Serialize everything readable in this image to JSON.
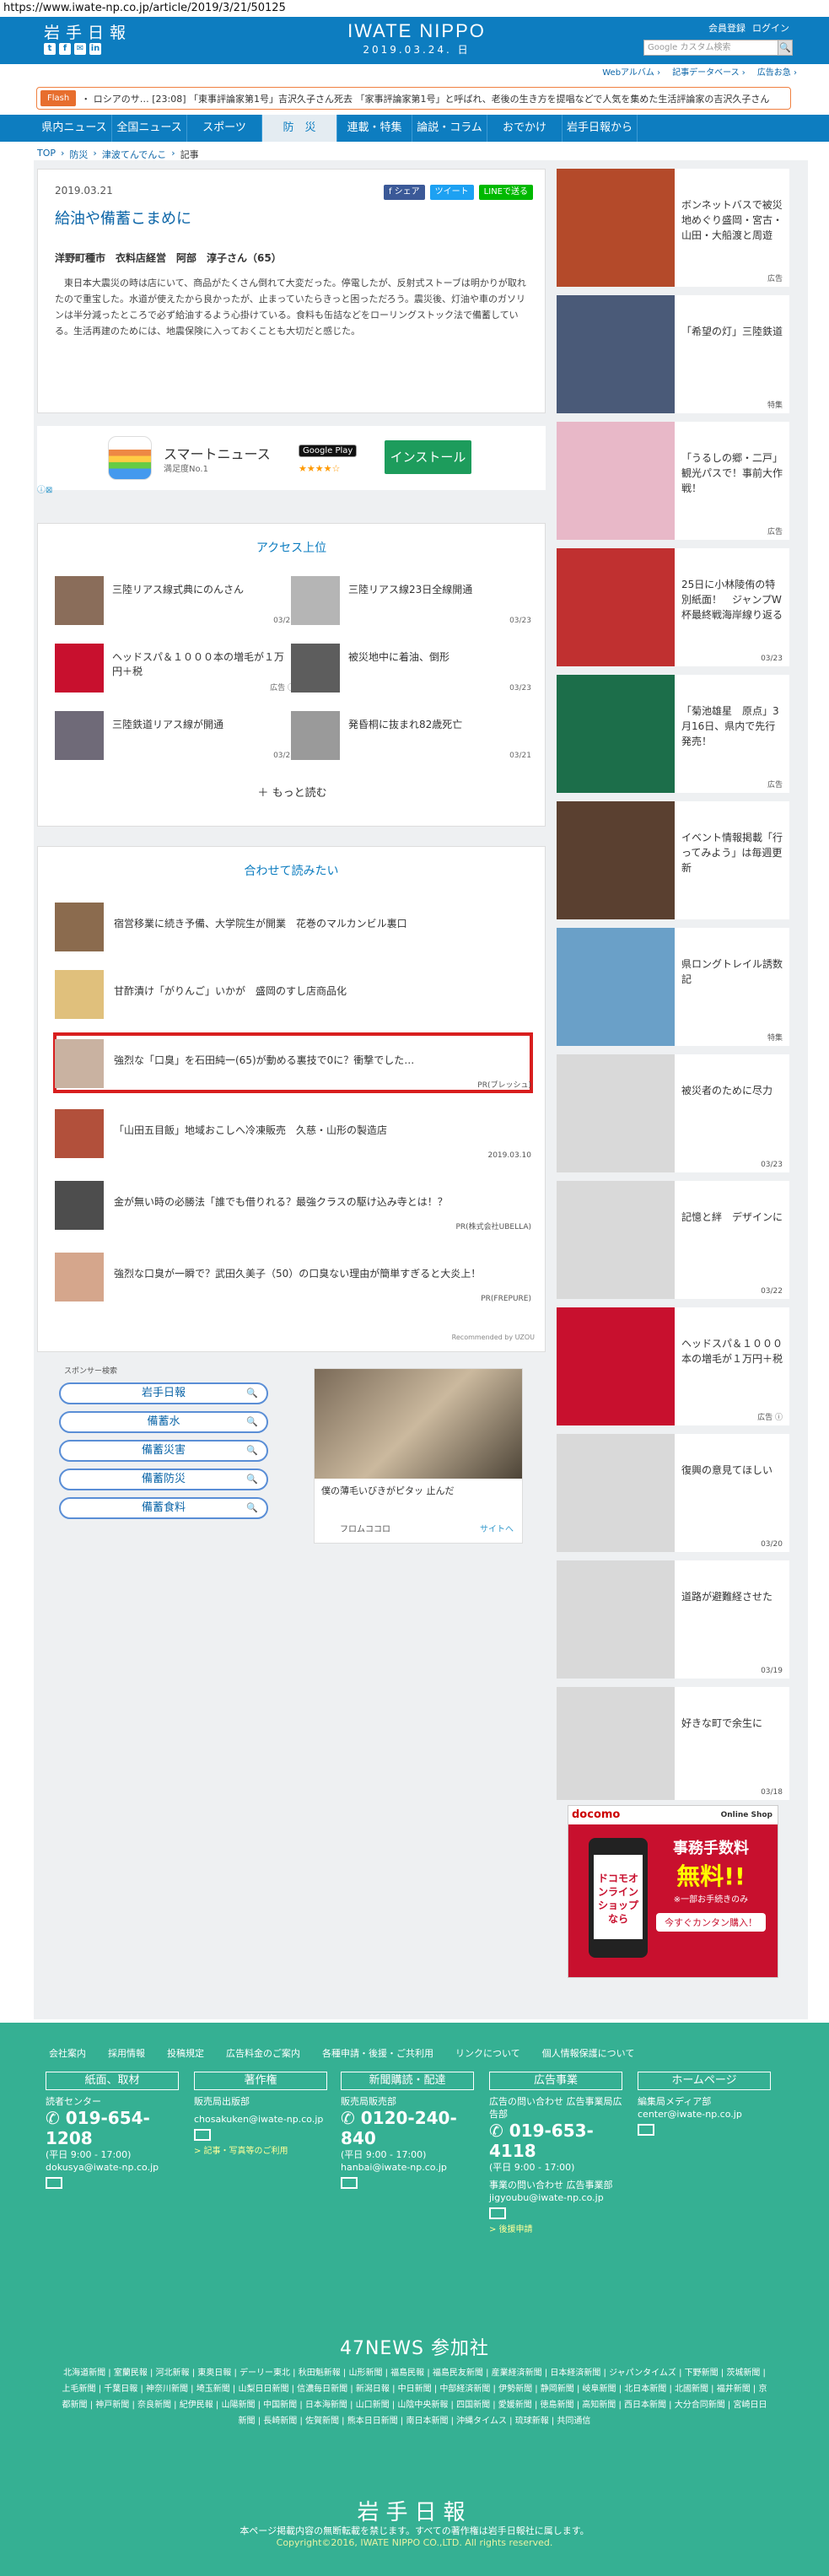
{
  "url": "https://www.iwate-np.co.jp/article/2019/3/21/50125",
  "header": {
    "logo_text": "岩手日報",
    "brand": "IWATE NIPPO",
    "date": "2019.03.24. 日",
    "member_register": "会員登録",
    "login": "ログイン",
    "search_placeholder": "Google カスタム検索",
    "social": [
      "t",
      "f",
      "✉",
      "in"
    ]
  },
  "subnav": [
    "Webアルバム ›",
    "記事データベース ›",
    "広告お急 ›"
  ],
  "flash": {
    "label": "Flash",
    "text": "・ ロシアのサ… [23:08] 「東事評論家第1号」吉沢久子さん死去 「家事評論家第1号」と呼ばれ、老後の生き方を提唱などで人気を集めた生活評論家の吉沢久子さん"
  },
  "nav": [
    "県内ニュース",
    "全国ニュース",
    "スポーツ",
    "防　災",
    "連載・特集",
    "論説・コラム",
    "おでかけ",
    "岩手日報から"
  ],
  "nav_active_index": 3,
  "breadcrumb": [
    "TOP",
    "防災",
    "津波てんでんこ",
    "記事"
  ],
  "article": {
    "date": "2019.03.21",
    "share_facebook": "f シェア",
    "share_twitter": "ツイート",
    "share_line": "LINEで送る",
    "title": "給油や備蓄こまめに",
    "byline": "洋野町種市　衣料店経営　阿部　淳子さん（65）",
    "body": "　東日本大震災の時は店にいて、商品がたくさん倒れて大変だった。停電したが、反射式ストーブは明かりが取れたので重宝した。水道が使えたから良かったが、止まっていたらきっと困っただろう。震災後、灯油や車のガソリンは半分減ったところで必ず給油するよう心掛けている。食料も缶詰などをローリングストック法で備蓄している。生活再建のためには、地震保険に入っておくことも大切だと感じた。"
  },
  "smartnews_ad": {
    "name": "スマートニュース",
    "rating_text": "満足度No.1",
    "store": "Google Play",
    "stars": "★★★★☆",
    "install": "インストール",
    "ad_mark": "ⓘ⊠"
  },
  "ranking": {
    "title": "アクセス上位",
    "items": [
      {
        "text": "三陸リアス線式典にのんさん",
        "date": "03/23"
      },
      {
        "text": "三陸リアス線23日全線開通",
        "date": "03/23"
      },
      {
        "text": "ヘッドスパ＆１０００本の増毛が１万円＋税",
        "date": "広告 ⓘ"
      },
      {
        "text": "被災地中に着油、倒形",
        "date": "03/23"
      },
      {
        "text": "三陸鉄道リアス線が開通",
        "date": "03/23"
      },
      {
        "text": "発昏桐に抜まれ82歳死亡",
        "date": "03/21"
      }
    ],
    "more": "もっと読む"
  },
  "recommend": {
    "title": "合わせて読みたい",
    "items": [
      {
        "text": "宿営移業に続き予備、大学院生が開業　花巻のマルカンビル裏口",
        "meta": ""
      },
      {
        "text": "甘酢漬け「がりんご」いかが　盛岡のすし店商品化",
        "meta": ""
      },
      {
        "text": "強烈な「口臭」を石田純一(65)が動める裏技で0に？衝撃でした…",
        "meta": "PR(ブレッシュ)"
      },
      {
        "text": "「山田五目飯」地域おこしへ冷凍販売　久慈・山形の製造店",
        "meta": "2019.03.10"
      },
      {
        "text": "金が無い時の必勝法「誰でも借りれる？最強クラスの駆け込み寺とは！？",
        "meta": "PR(株式会社UBELLA)"
      },
      {
        "text": "強烈な口臭が一瞬で？武田久美子（50）の口臭ない理由が簡単すぎると大炎上！",
        "meta": "PR(FREPURE)"
      }
    ],
    "credit": "Recommended by UZOU"
  },
  "sponsor": {
    "title": "スポンサー検索",
    "items": [
      "岩手日報",
      "備蓄水",
      "備蓄災害",
      "備蓄防災",
      "備蓄食料"
    ]
  },
  "hair_ad": {
    "caption": "僕の薄毛いびきがピタッ 止んだ",
    "source": "フロムココロ",
    "site": "サイトへ"
  },
  "sidebar": [
    {
      "text": "ボンネットバスで被災地めぐり盛岡・宮古・山田・大船渡と周遊",
      "meta": "広告"
    },
    {
      "text": "「希望の灯」三陸鉄道",
      "meta": "特集"
    },
    {
      "text": "「うるしの郷・二戸」観光パスで！事前大作戦！",
      "meta": "広告"
    },
    {
      "text": "25日に小林陵侑の特別紙面！　ジャンプW杯最終戦海岸線り返る",
      "meta": "03/23"
    },
    {
      "text": "「菊池雄星　原点」3月16日、県内で先行発売！",
      "meta": "広告"
    },
    {
      "text": "イベント情報掲載「行ってみよう」は毎週更新",
      "meta": ""
    },
    {
      "text": "県ロングトレイル誘数記",
      "meta": "特集"
    },
    {
      "text": "被災者のために尽力",
      "meta": "03/23"
    },
    {
      "text": "記憶と絆　デザインに",
      "meta": "03/22"
    },
    {
      "text": "ヘッドスパ＆１０００本の増毛が１万円＋税",
      "meta": "広告 ⓘ"
    },
    {
      "text": "復興の意見てほしい",
      "meta": "03/20"
    },
    {
      "text": "道路が避難経させた",
      "meta": "03/19"
    },
    {
      "text": "好きな町で余生に",
      "meta": "03/18"
    }
  ],
  "docomo_ad": {
    "brand": "docomo",
    "shop": "Online Shop",
    "phone_text": "ドコモオンラインショップなら",
    "line1": "事務手数料",
    "line2": "無料!!",
    "line3": "※一部お手続きのみ",
    "cta": "今すぐカンタン購入！"
  },
  "footer": {
    "links": [
      "会社案内",
      "採用情報",
      "投稿規定",
      "広告料金のご案内",
      "各種申請・後援・ご共利用",
      "リンクについて",
      "個人情報保護について"
    ],
    "cols": [
      {
        "head": "紙面、取材",
        "l1": "読者センター",
        "big": "019-654-1208",
        "l2": "(平日 9:00 - 17:00)",
        "l3": "dokusya@iwate-np.co.jp",
        "l4": ""
      },
      {
        "head": "著作権",
        "l1": "販売局出版部",
        "big": "",
        "l2": "",
        "l3": "chosakuken@iwate-np.co.jp",
        "l4": "> 記事・写真等のご利用"
      },
      {
        "head": "新聞購読・配達",
        "l1": "販売局販売部",
        "big": "0120-240-840",
        "l2": "(平日 9:00 - 17:00)",
        "l3": "hanbai@iwate-np.co.jp",
        "l4": ""
      },
      {
        "head": "広告事業",
        "l1": "広告の問い合わせ 広告事業局広告部",
        "big": "019-653-4118",
        "l2": "(平日 9:00 - 17:00)",
        "l3": "事業の問い合わせ 広告事業部 jigyoubu@iwate-np.co.jp",
        "l4": "> 後援申請"
      },
      {
        "head": "ホームページ",
        "l1": "編集局メディア部",
        "big": "",
        "l2": "",
        "l3": "center@iwate-np.co.jp",
        "l4": ""
      }
    ],
    "news47_title": "47NEWS 参加社",
    "news47_list": "北海道新聞 | 室蘭民報 | 河北新報 | 東奥日報 | デーリー東北 | 秋田魁新報 | 山形新聞 | 福島民報 | 福島民友新聞 | 産業経済新聞 | 日本経済新聞 | ジャパンタイムズ | 下野新聞 | 茨城新聞 | 上毛新聞 | 千葉日報 | 神奈川新聞 | 埼玉新聞 | 山梨日日新聞 | 信濃毎日新聞 | 新潟日報 | 中日新聞 | 中部経済新聞 | 伊勢新聞 | 静岡新聞 | 岐阜新聞 | 北日本新聞 | 北國新聞 | 福井新聞 | 京都新聞 | 神戸新聞 | 奈良新聞 | 紀伊民報 | 山陽新聞 | 中国新聞 | 日本海新聞 | 山口新聞 | 山陰中央新報 | 四国新聞 | 愛媛新聞 | 徳島新聞 | 高知新聞 | 西日本新聞 | 大分合同新聞 | 宮崎日日新聞 | 長崎新聞 | 佐賀新聞 | 熊本日日新聞 | 南日本新聞 | 沖縄タイムス | 琉球新報 | 共同通信",
    "logo": "岩手日報",
    "notice": "本ページ掲載内容の無断転載を禁じます。すべての著作権は岩手日報社に属します。",
    "copyright": "Copyright©2016, IWATE NIPPO CO.,LTD. All rights reserved."
  }
}
